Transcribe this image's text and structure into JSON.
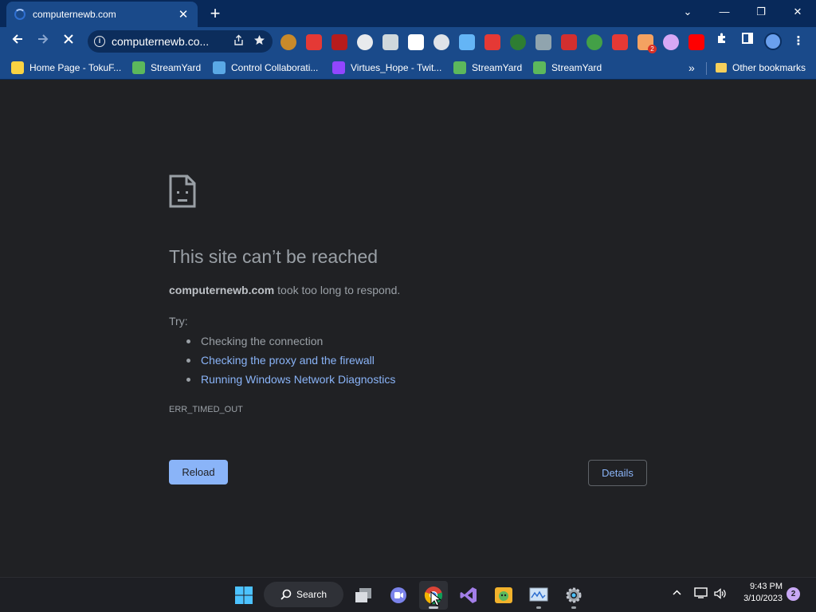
{
  "browser": {
    "tab": {
      "title": "computernewb.com",
      "close_glyph": "✕"
    },
    "new_tab_glyph": "+",
    "window_controls": {
      "minimize": "—",
      "maximize": "❐",
      "close": "✕",
      "tab_search": "⌄"
    },
    "omnibox": {
      "url": "computernewb.co...",
      "info_glyph": "i"
    },
    "extensions": [
      {
        "name": "ext-k",
        "color": "#c98a2a"
      },
      {
        "name": "ext-red-check",
        "color": "#e53935"
      },
      {
        "name": "ext-dark-red",
        "color": "#b71c1c"
      },
      {
        "name": "ext-white-square",
        "color": "#e8eaed"
      },
      {
        "name": "ext-d-badge",
        "color": "#cfd8dc"
      },
      {
        "name": "ext-cbl",
        "color": "#ffffff"
      },
      {
        "name": "ext-mouse",
        "color": "#dfe3e8"
      },
      {
        "name": "ext-blue-cube",
        "color": "#64b5f6"
      },
      {
        "name": "ext-red-bar",
        "color": "#e53935"
      },
      {
        "name": "ext-green-circle",
        "color": "#2e7d32"
      },
      {
        "name": "ext-hammer",
        "color": "#90a4ae"
      },
      {
        "name": "ext-red-square",
        "color": "#d32f2f"
      },
      {
        "name": "ext-dollar",
        "color": "#43a047"
      },
      {
        "name": "ext-red-box",
        "color": "#e53935"
      },
      {
        "name": "ext-orange-badge",
        "color": "#f4a261"
      },
      {
        "name": "ext-game",
        "color": "#d7a8f5"
      },
      {
        "name": "ext-youtube",
        "color": "#ff0000"
      }
    ],
    "extension_badge": "2",
    "bookmarks": [
      {
        "label": "Home Page - TokuF...",
        "color": "#f9d342"
      },
      {
        "label": "StreamYard",
        "color": "#5cb85c"
      },
      {
        "label": "Control Collaborati...",
        "color": "#5aa9e6"
      },
      {
        "label": "Virtues_Hope - Twit...",
        "color": "#9146ff"
      },
      {
        "label": "StreamYard",
        "color": "#5cb85c"
      },
      {
        "label": "StreamYard",
        "color": "#5cb85c"
      }
    ],
    "bookmarks_more": "»",
    "other_bookmarks": "Other bookmarks"
  },
  "error_page": {
    "heading": "This site can’t be reached",
    "domain": "computernewb.com",
    "description_suffix": " took too long to respond.",
    "try_label": "Try:",
    "suggestions": [
      {
        "text": "Checking the connection",
        "link": false
      },
      {
        "text": "Checking the proxy and the firewall",
        "link": true
      },
      {
        "text": "Running Windows Network Diagnostics",
        "link": true
      }
    ],
    "error_code": "ERR_TIMED_OUT",
    "reload_label": "Reload",
    "details_label": "Details"
  },
  "taskbar": {
    "search_label": "Search",
    "clock_time": "9:43 PM",
    "clock_date": "3/10/2023",
    "notification_count": "2",
    "tray_chevron": "⌃"
  },
  "colors": {
    "page_bg": "#202124",
    "chrome_frame": "#08295a",
    "toolbar": "#1a4a8a",
    "link_blue": "#8ab4f8",
    "text_gray": "#9aa0a6"
  }
}
